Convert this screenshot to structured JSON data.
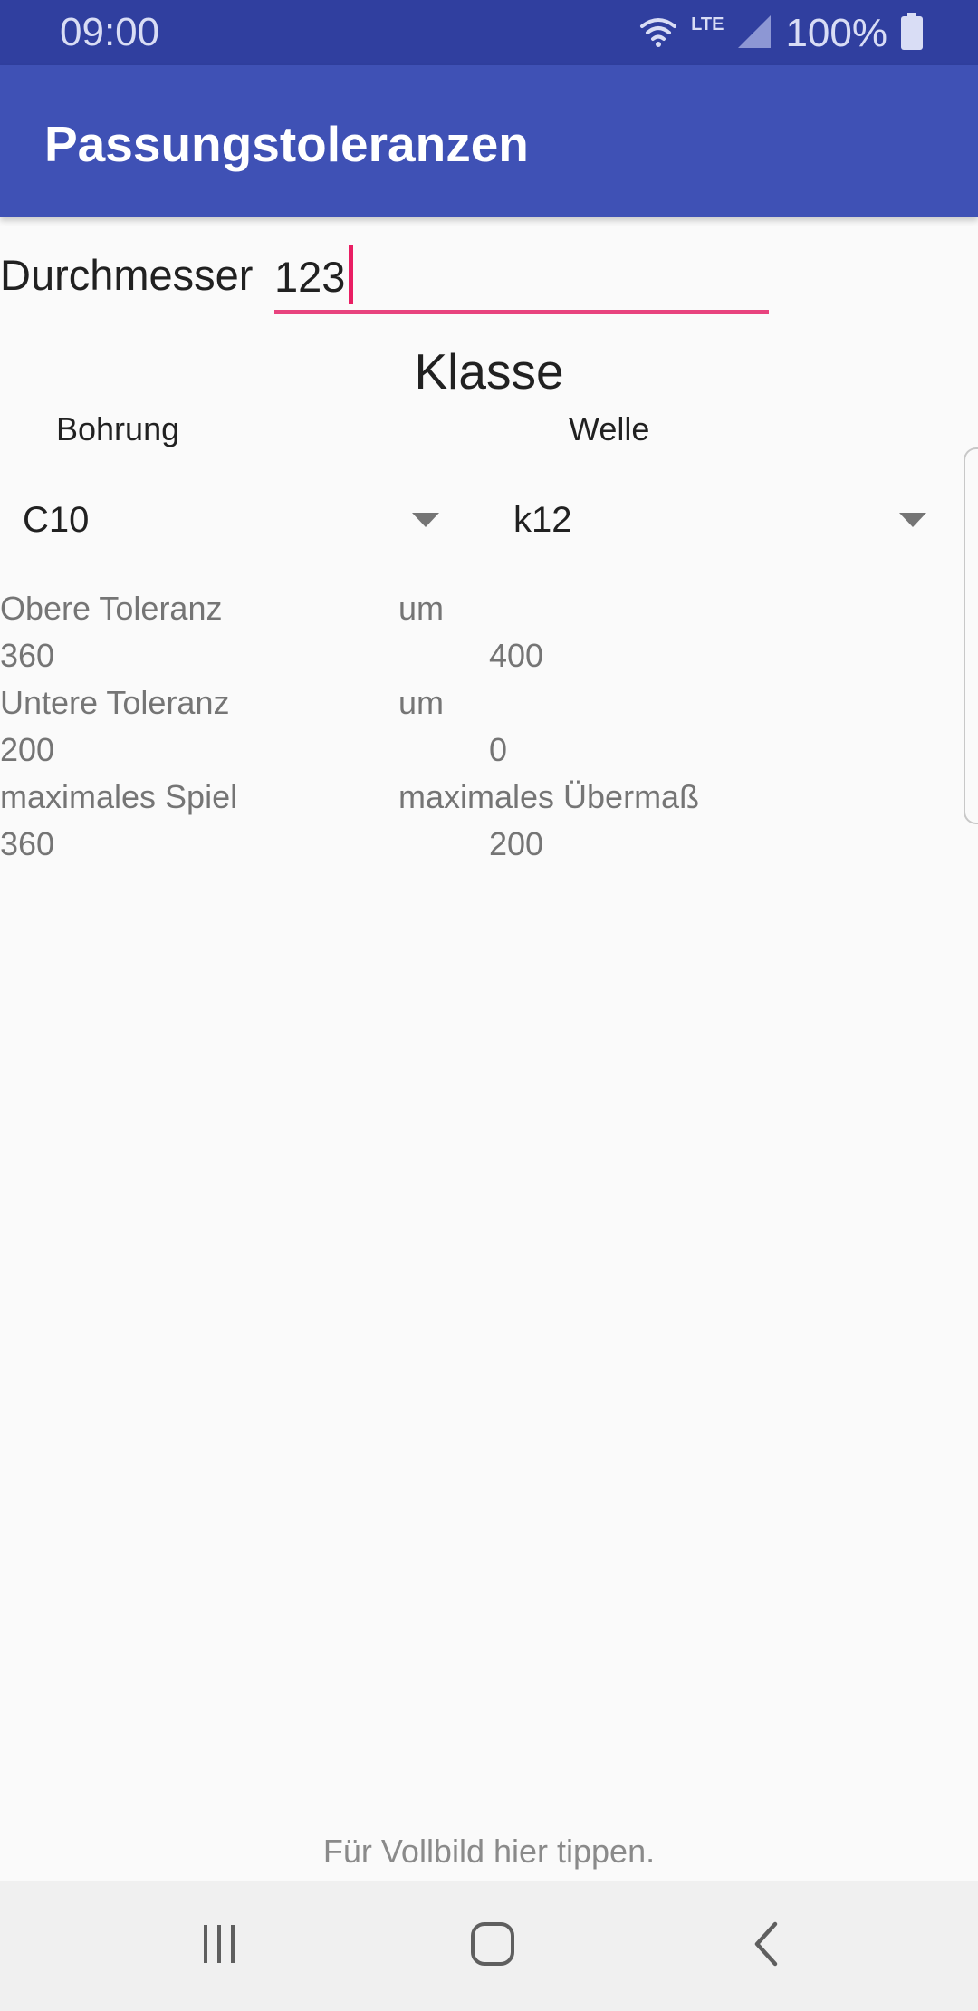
{
  "status_bar": {
    "time": "09:00",
    "network": "LTE",
    "battery": "100%"
  },
  "app_bar": {
    "title": "Passungstoleranzen"
  },
  "diameter": {
    "label": "Durchmesser",
    "value": "123"
  },
  "klasse": {
    "title": "Klasse",
    "bohrung": {
      "label": "Bohrung",
      "selected": "C10"
    },
    "welle": {
      "label": "Welle",
      "selected": "k12"
    }
  },
  "results": {
    "obere_label": "Obere Toleranz",
    "obere_unit": "um",
    "obere_bohrung": "360",
    "obere_welle": "400",
    "untere_label": "Untere Toleranz",
    "untere_unit": "um",
    "untere_bohrung": "200",
    "untere_welle": "0",
    "spiel_label": "maximales Spiel",
    "uebermass_label": "maximales Übermaß",
    "spiel_value": "360",
    "uebermass_value": "200"
  },
  "footer_hint": "Für Vollbild hier tippen.",
  "colors": {
    "status_bar": "#303f9f",
    "app_bar": "#3f51b5",
    "accent": "#e91e63",
    "background": "#fafafa"
  },
  "icons": {
    "wifi": "wifi-icon",
    "signal": "signal-icon",
    "battery": "battery-icon",
    "recents": "recents-icon",
    "home": "home-icon",
    "back": "back-icon"
  }
}
